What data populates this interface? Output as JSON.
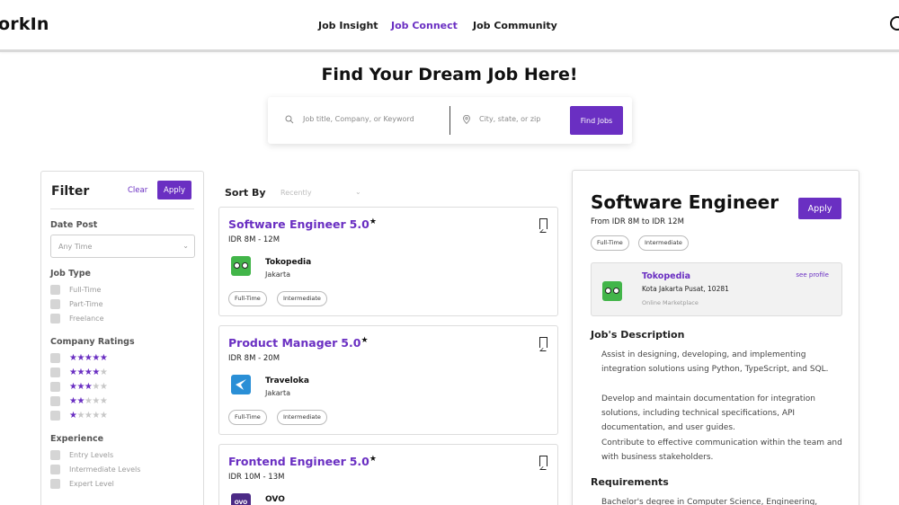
{
  "nav": {
    "brand": "orkIn",
    "links": [
      "Job Insight",
      "Job Connect",
      "Job Community"
    ],
    "active_link": "Job Connect"
  },
  "hero": {
    "title": "Find Your Dream Job Here!",
    "keyword_placeholder": "Job title, Company, or Keyword",
    "location_placeholder": "City, state, or zip",
    "find_button": "Find Jobs"
  },
  "filter": {
    "title": "Filter",
    "clear": "Clear",
    "apply": "Apply",
    "date_post_label": "Date Post",
    "date_post_value": "Any Time",
    "job_type_label": "Job Type",
    "job_types": [
      "Full-Time",
      "Part-Time",
      "Freelance"
    ],
    "company_ratings_label": "Company Ratings",
    "ratings": [
      5,
      4,
      3,
      2,
      1
    ],
    "experience_label": "Experience",
    "experience_levels": [
      "Entry Levels",
      "Intermediate Levels",
      "Expert Level"
    ]
  },
  "sort": {
    "label": "Sort By",
    "value": "Recently"
  },
  "jobs": [
    {
      "title": "Software Engineer",
      "rating": "5.0",
      "salary": "IDR 8M - 12M",
      "company": "Tokopedia",
      "city": "Jakarta",
      "tags": [
        "Full-Time",
        "Intermediate"
      ]
    },
    {
      "title": "Product Manager",
      "rating": "5.0",
      "salary": "IDR 8M - 20M",
      "company": "Traveloka",
      "city": "Jakarta",
      "tags": [
        "Full-Time",
        "Intermediate"
      ]
    },
    {
      "title": "Frontend Engineer",
      "rating": "5.0",
      "salary": "IDR 10M - 13M",
      "company": "OVO",
      "logo_text": "OVO"
    }
  ],
  "detail": {
    "title": "Software Engineer",
    "apply": "Apply",
    "salary": "From IDR 8M to IDR 12M",
    "tags": [
      "Full-Time",
      "Intermediate"
    ],
    "company": "Tokopedia",
    "see_profile": "see profile",
    "address": "Kota Jakarta Pusat, 10281",
    "company_type": "Online Marketplace",
    "description_title": "Job's Description",
    "description": [
      "Assist in designing, developing, and implementing integration solutions using Python, TypeScript, and SQL.",
      "Develop and maintain documentation for integration solutions, including technical specifications, API documentation, and user guides.",
      "Contribute to effective communication within the team and with business stakeholders."
    ],
    "requirements_title": "Requirements",
    "requirements_first": "Bachelor's degree in Computer Science, Engineering,"
  },
  "colors": {
    "accent": "#6a2fc2",
    "tokopedia": "#42b549",
    "traveloka": "#2a8fd6",
    "ovo": "#4c2a86"
  }
}
